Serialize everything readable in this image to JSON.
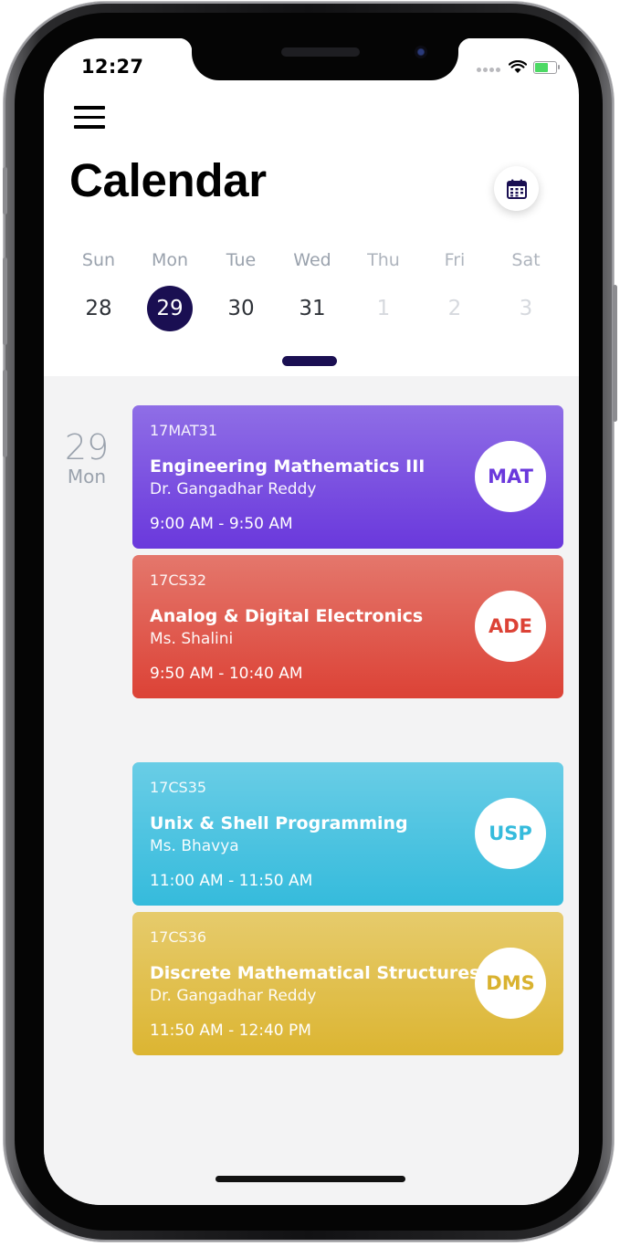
{
  "status_bar": {
    "time": "12:27"
  },
  "header": {
    "title": "Calendar"
  },
  "week": [
    {
      "name": "Sun",
      "date": "28"
    },
    {
      "name": "Mon",
      "date": "29"
    },
    {
      "name": "Tue",
      "date": "30"
    },
    {
      "name": "Wed",
      "date": "31"
    },
    {
      "name": "Thu",
      "date": "1"
    },
    {
      "name": "Fri",
      "date": "2"
    },
    {
      "name": "Sat",
      "date": "3"
    }
  ],
  "selected_day": {
    "date": "29",
    "day": "Mon"
  },
  "classes": [
    {
      "code": "17MAT31",
      "subject": "Engineering Mathematics III",
      "teacher": "Dr. Gangadhar Reddy",
      "time": "9:00 AM - 9:50 AM",
      "abbr": "MAT",
      "color_top": "#8f6ee6",
      "color_bottom": "#6a38dc",
      "abbr_color": "#6a38dc"
    },
    {
      "code": "17CS32",
      "subject": "Analog & Digital Electronics",
      "teacher": "Ms. Shalini",
      "time": "9:50 AM - 10:40 AM",
      "abbr": "ADE",
      "color_top": "#e4776c",
      "color_bottom": "#dc4236",
      "abbr_color": "#dc4236"
    },
    {
      "code": "17CS35",
      "subject": "Unix & Shell Programming",
      "teacher": "Ms. Bhavya",
      "time": "11:00 AM - 11:50 AM",
      "abbr": "USP",
      "color_top": "#69cde6",
      "color_bottom": "#35bbdc",
      "abbr_color": "#35bbdc"
    },
    {
      "code": "17CS36",
      "subject": "Discrete Mathematical Structures",
      "teacher": "Dr. Gangadhar Reddy",
      "time": "11:50 AM - 12:40 PM",
      "abbr": "DMS",
      "color_top": "#e6cb6c",
      "color_bottom": "#dcb532",
      "abbr_color": "#d9b22f"
    }
  ],
  "colors": {
    "accent": "#1a0f52",
    "background": "#f3f3f4"
  }
}
